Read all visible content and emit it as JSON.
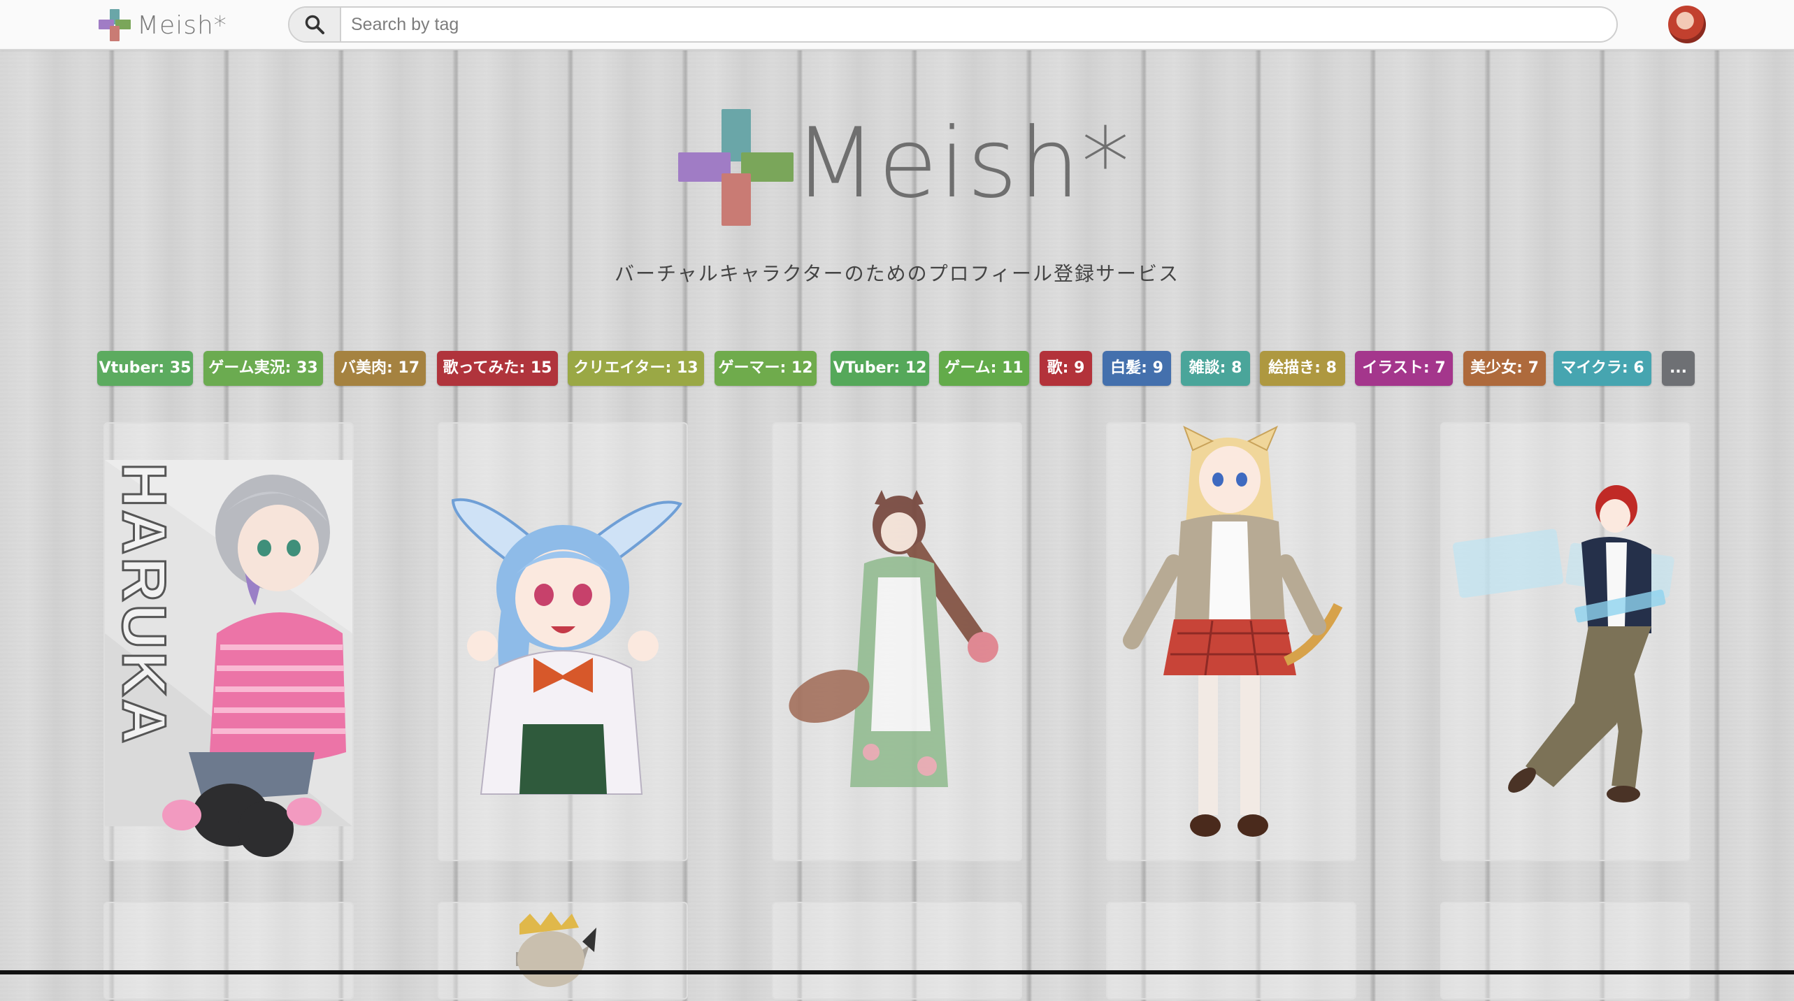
{
  "header": {
    "brand": "Meish*",
    "search_placeholder": "Search by tag",
    "search_icon": "search-icon",
    "avatar": "user-avatar"
  },
  "hero": {
    "logo_text": "Meish*",
    "tagline": "バーチャルキャラクターのためのプロフィール登録サービス"
  },
  "colors": {
    "logo_teal": "#6aa6a8",
    "logo_purple": "#a07cc5",
    "logo_green": "#7aa65a",
    "logo_red": "#c97b74"
  },
  "tags": [
    {
      "label": "Vtuber: 35",
      "color": "#5cab5f"
    },
    {
      "label": "ゲーム実況: 33",
      "color": "#6bab50"
    },
    {
      "label": "バ美肉: 17",
      "color": "#a58240"
    },
    {
      "label": "歌ってみた: 15",
      "color": "#b0343c"
    },
    {
      "label": "クリエイター: 13",
      "color": "#9aa845"
    },
    {
      "label": "ゲーマー: 12",
      "color": "#6fab4c"
    },
    {
      "label": "VTuber: 12",
      "color": "#55a85a"
    },
    {
      "label": "ゲーム: 11",
      "color": "#63ab4a"
    },
    {
      "label": "歌: 9",
      "color": "#b3323a"
    },
    {
      "label": "白髪: 9",
      "color": "#4470ad"
    },
    {
      "label": "雑談: 8",
      "color": "#4aa59a"
    },
    {
      "label": "絵描き: 8",
      "color": "#ae9840"
    },
    {
      "label": "イラスト: 7",
      "color": "#a4368c"
    },
    {
      "label": "美少女: 7",
      "color": "#ae6a3c"
    },
    {
      "label": "マイクラ: 6",
      "color": "#46a5b0"
    },
    {
      "label": "...",
      "color": "#6e7074"
    }
  ],
  "cards": [
    {
      "name": "character-card-haruka",
      "caption": "HARUKA"
    },
    {
      "name": "character-card-bunny"
    },
    {
      "name": "character-card-kimono"
    },
    {
      "name": "character-card-catgirl"
    },
    {
      "name": "character-card-redhair"
    }
  ]
}
